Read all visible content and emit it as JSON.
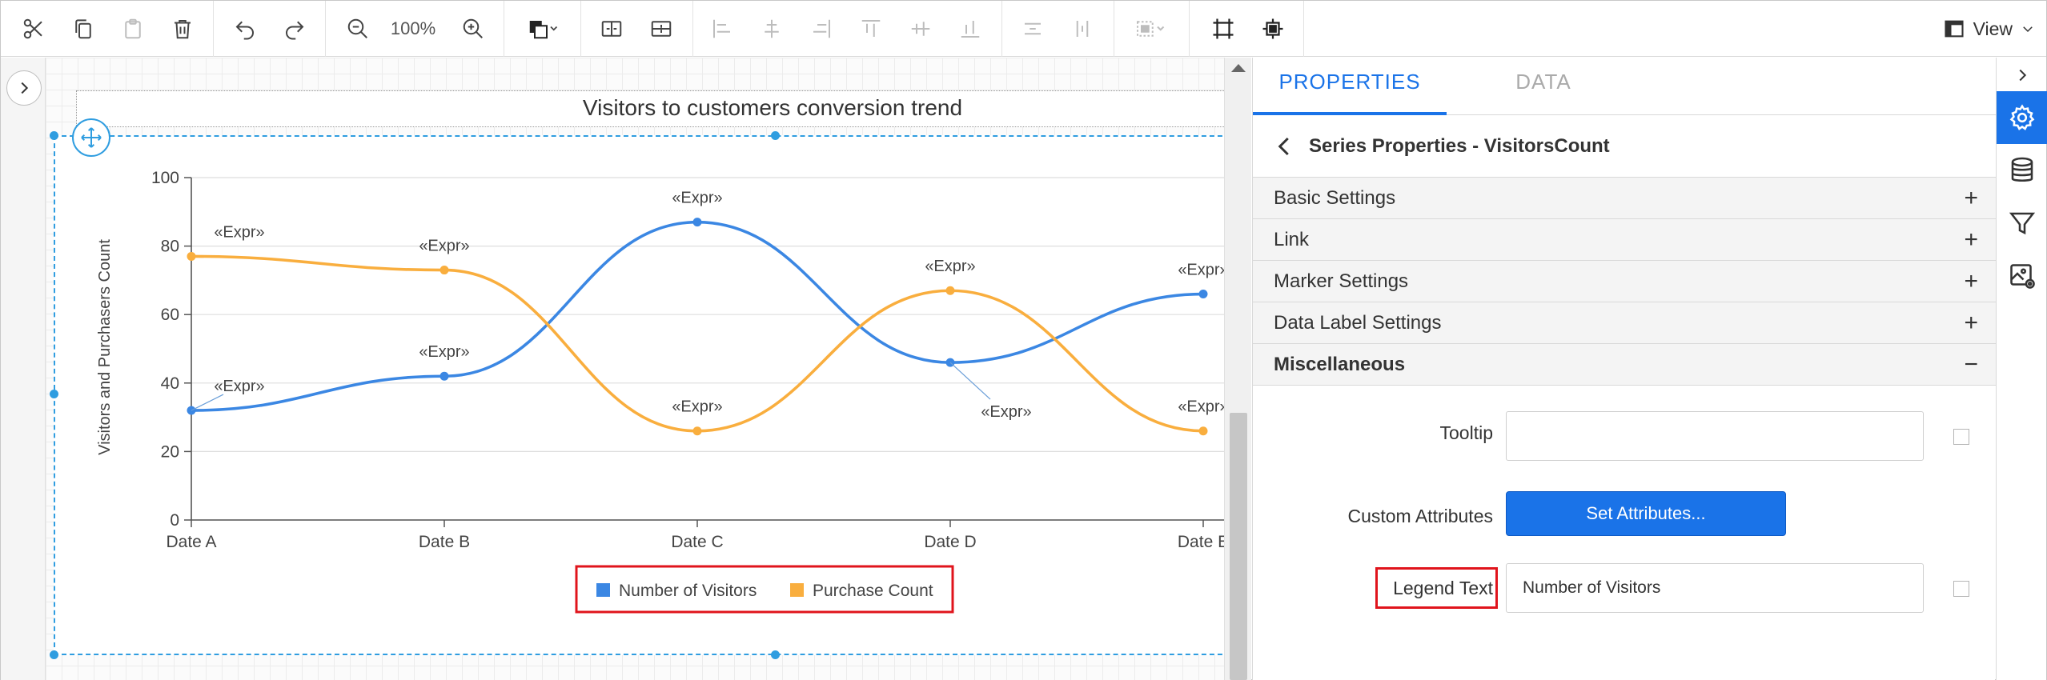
{
  "toolbar": {
    "zoom": "100%",
    "view_label": "View",
    "tools": [
      "cut-icon",
      "copy-icon",
      "paste-icon",
      "delete-icon",
      "undo-icon",
      "redo-icon",
      "zoom-out-icon",
      "zoom-in-icon",
      "fill-color-icon",
      "group-icon",
      "ungroup-icon",
      "align-left-icon",
      "align-center-icon",
      "align-right-icon",
      "align-top-icon",
      "align-middle-icon",
      "align-bottom-icon",
      "distribute-horizontal-icon",
      "distribute-vertical-icon",
      "size-icon",
      "fit-to-page-icon",
      "fit-to-screen-icon",
      "view-icon"
    ]
  },
  "chart_data": {
    "type": "line",
    "title": "Visitors to customers conversion trend",
    "ylabel": "Visitors and Purchasers Count",
    "xlabel": "",
    "categories": [
      "Date A",
      "Date B",
      "Date C",
      "Date D",
      "Date E"
    ],
    "ylim": [
      0,
      100
    ],
    "yticks": [
      0,
      20,
      40,
      60,
      80,
      100
    ],
    "grid": true,
    "legend_position": "bottom",
    "series": [
      {
        "name": "Number of Visitors",
        "color": "#3b87e3",
        "values": [
          32,
          42,
          87,
          46,
          66
        ]
      },
      {
        "name": "Purchase Count",
        "color": "#f9ae3e",
        "values": [
          77,
          73,
          26,
          67,
          26
        ]
      }
    ],
    "data_label": "«Expr»"
  },
  "panel": {
    "tabs": {
      "properties": "PROPERTIES",
      "data": "DATA"
    },
    "title": "Series Properties - VisitorsCount",
    "sections": {
      "basic": "Basic Settings",
      "link": "Link",
      "marker": "Marker Settings",
      "data_label": "Data Label Settings",
      "misc": "Miscellaneous"
    },
    "toggles": {
      "collapsed": "+",
      "expanded": "−"
    },
    "tooltip_label": "Tooltip",
    "tooltip_value": "",
    "custom_attributes_label": "Custom Attributes",
    "set_attributes_label": "Set Attributes...",
    "legend_text_label": "Legend Text",
    "legend_text_value": "Number of Visitors"
  },
  "strip": [
    "settings-icon",
    "database-icon",
    "filter-icon",
    "image-settings-icon"
  ],
  "colors": {
    "accent": "#1a73e8",
    "highlight": "#e0141c",
    "selection": "#2f9de0"
  }
}
